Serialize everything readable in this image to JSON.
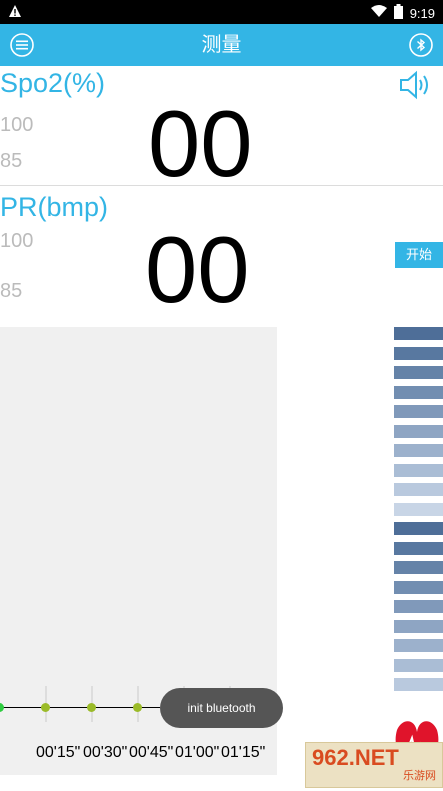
{
  "status_bar": {
    "time": "9:19",
    "warning_icon": "warning-icon",
    "wifi_icon": "wifi-icon",
    "battery_icon": "battery-icon"
  },
  "app_bar": {
    "title": "测量",
    "menu_icon": "menu-icon",
    "bluetooth_icon": "bluetooth-icon"
  },
  "spo2": {
    "label": "Spo2(%)",
    "upper_limit": "100",
    "lower_limit": "85",
    "value": "00"
  },
  "pr": {
    "label": "PR(bmp)",
    "upper_limit": "100",
    "lower_limit": "85",
    "value": "00"
  },
  "start_button": {
    "label": "开始"
  },
  "timeline": {
    "labels": [
      "00'15\"",
      "00'30\"",
      "00'45\"",
      "01'00\"",
      "01'15\""
    ]
  },
  "toast": {
    "text": "init bluetooth"
  },
  "colors": {
    "accent": "#33b5e5",
    "dot": "#9bbb28",
    "heart": "#e0142b"
  },
  "watermark": {
    "logo": "962.NET",
    "sub": "乐游网"
  }
}
